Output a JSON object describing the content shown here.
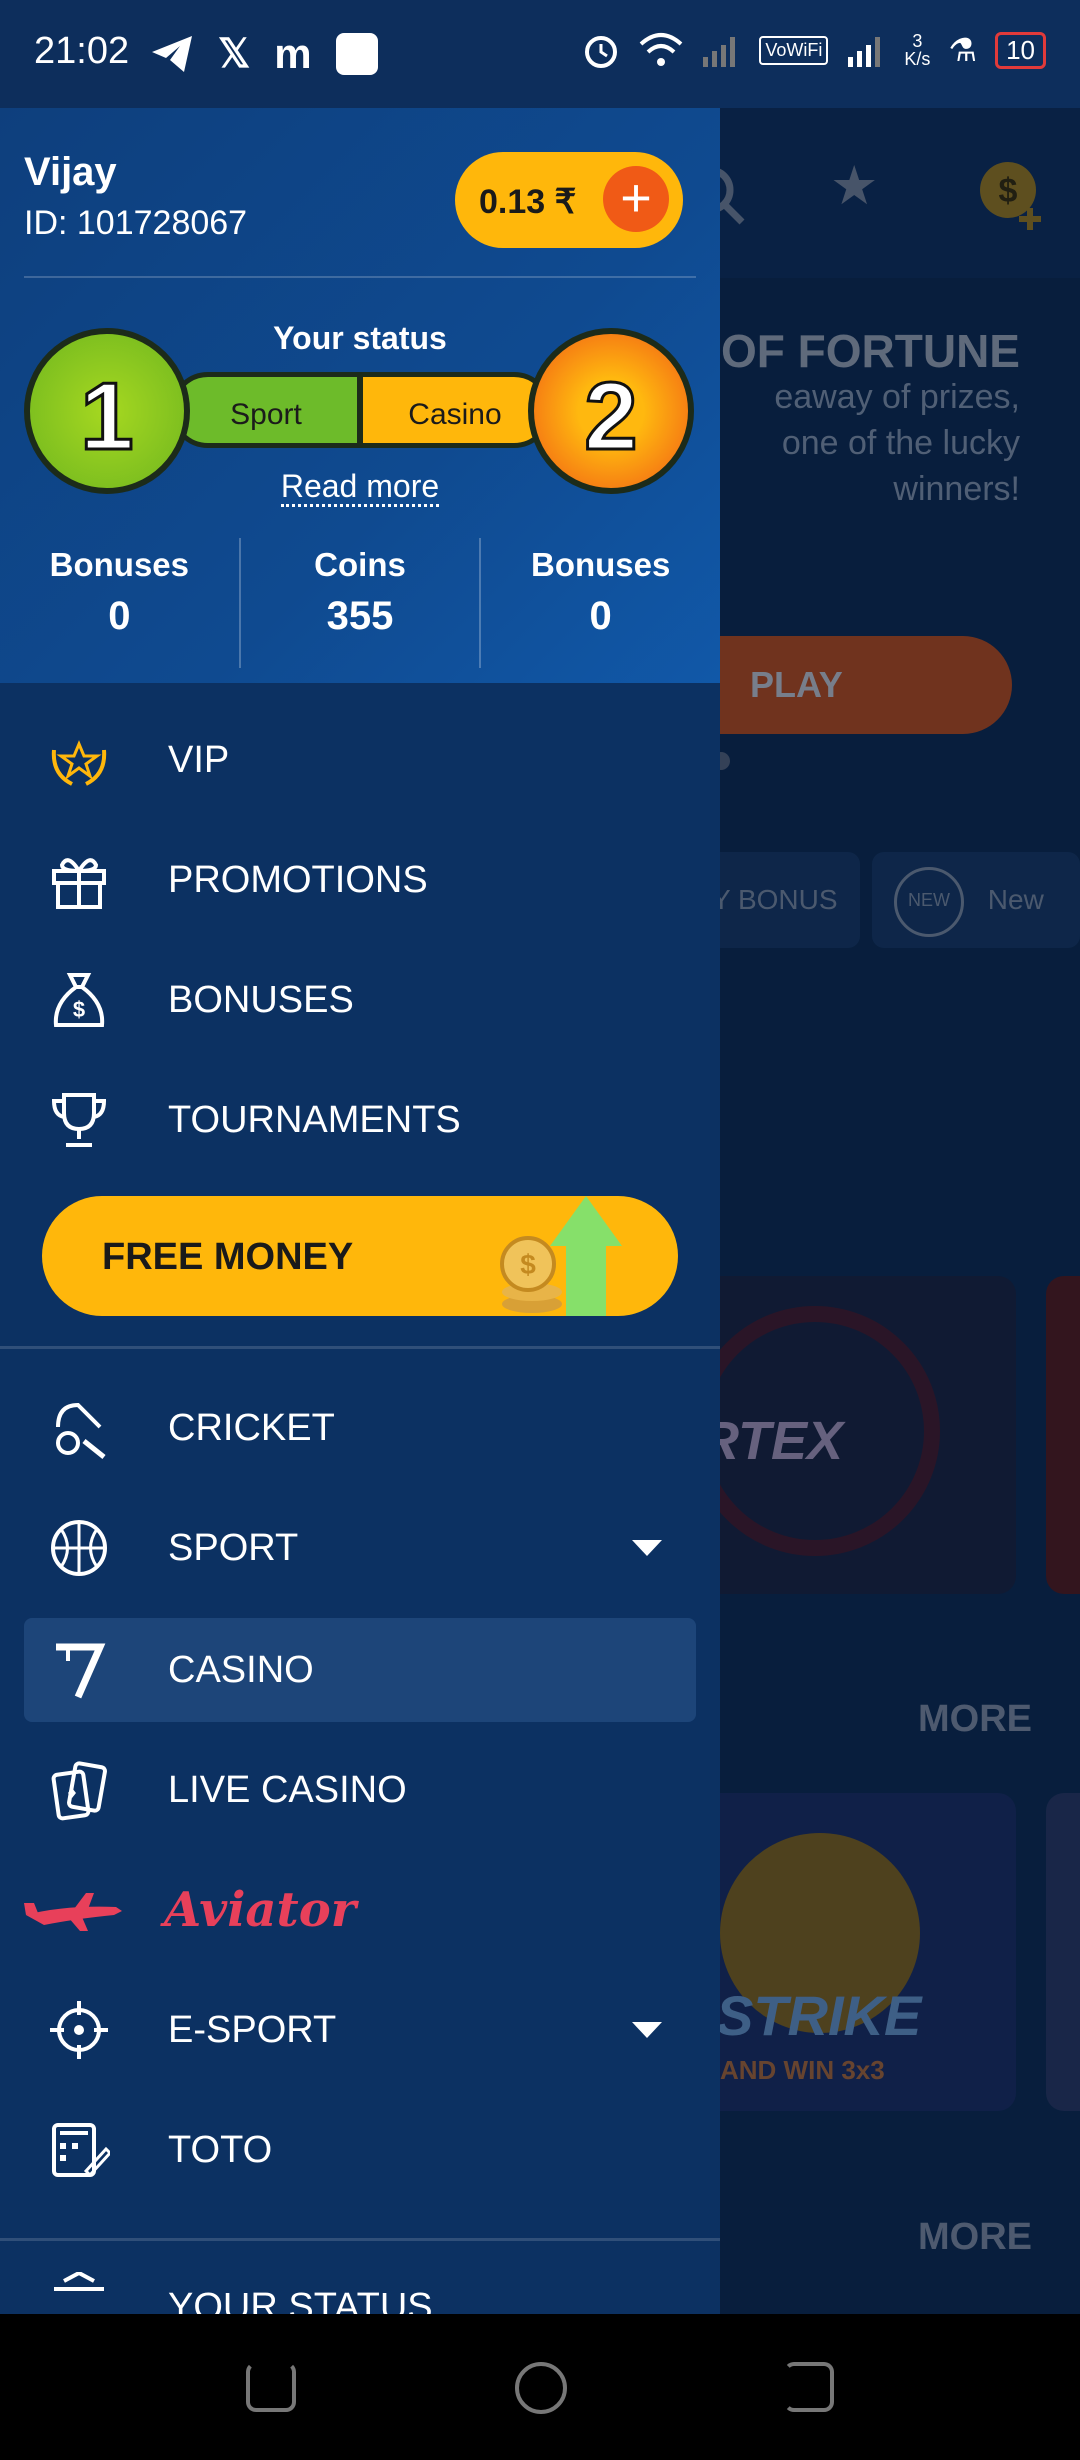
{
  "status_bar": {
    "time": "21:02",
    "vowifi": "VoWiFi",
    "speed_top": "3",
    "speed_bottom": "K/s",
    "battery": "10"
  },
  "background_page": {
    "banner_title": "OF FORTUNE",
    "banner_line1": "eaway of prizes,",
    "banner_line2": "one of the lucky",
    "banner_line3": "winners!",
    "play_label": "PLAY",
    "chip1_label": "Y BONUS",
    "chip2_badge": "NEW",
    "chip2_label": "New",
    "game1_title": "RTEX",
    "game2_title": "STRIKE",
    "game2_subtitle": "AND WIN 3x3",
    "more_label": "MORE"
  },
  "drawer": {
    "user_name": "Vijay",
    "user_id": "ID: 101728067",
    "balance": "0.13 ₹",
    "status_title": "Your status",
    "level_sport": "1",
    "level_casino": "2",
    "pill_sport": "Sport",
    "pill_casino": "Casino",
    "read_more": "Read more",
    "stats": [
      {
        "label": "Bonuses",
        "value": "0"
      },
      {
        "label": "Coins",
        "value": "355"
      },
      {
        "label": "Bonuses",
        "value": "0"
      }
    ],
    "menu_top": [
      {
        "label": "VIP",
        "icon": "laurel-star-icon"
      },
      {
        "label": "PROMOTIONS",
        "icon": "gift-icon"
      },
      {
        "label": "BONUSES",
        "icon": "money-bag-icon"
      },
      {
        "label": "TOURNAMENTS",
        "icon": "trophy-icon"
      }
    ],
    "free_money": "FREE MONEY",
    "menu_main": [
      {
        "label": "CRICKET",
        "icon": "cricket-icon"
      },
      {
        "label": "SPORT",
        "icon": "basketball-icon"
      },
      {
        "label": "CASINO",
        "icon": "seven-icon"
      },
      {
        "label": "LIVE CASINO",
        "icon": "cards-icon"
      },
      {
        "label": "Aviator",
        "icon": "plane-icon"
      },
      {
        "label": "E-SPORT",
        "icon": "crosshair-icon"
      },
      {
        "label": "TOTO",
        "icon": "calculator-icon"
      }
    ],
    "partial_item": "YOUR STATUS"
  },
  "colors": {
    "accent_yellow": "#ffb70b",
    "accent_orange": "#f05a16",
    "drawer_bg": "#0c3162",
    "active_bg": "#1d4579",
    "aviator_red": "#e8405a"
  }
}
